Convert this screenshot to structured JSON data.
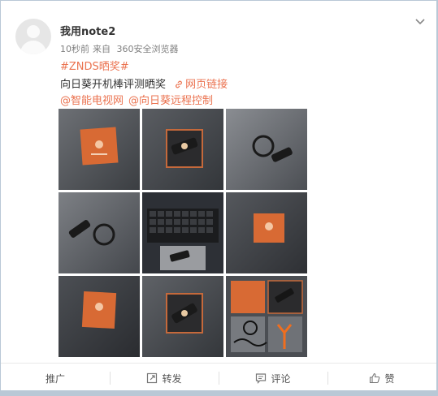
{
  "post": {
    "username": "我用note2",
    "time": "10秒前",
    "from_label": "来自",
    "source": "360安全浏览器",
    "hashtag": "#ZNDS晒奖#",
    "text": "向日葵开机棒评测晒奖",
    "link_label": "网页链接",
    "mention_1": "@智能电视网",
    "mention_2": "@向日葵远程控制"
  },
  "photos": [
    {
      "subject": "orange-box"
    },
    {
      "subject": "stick-on-box"
    },
    {
      "subject": "dell-laptop-stick"
    },
    {
      "subject": "dell-laptop-stick-rotated"
    },
    {
      "subject": "laptop-keyboard"
    },
    {
      "subject": "orange-box"
    },
    {
      "subject": "orange-box"
    },
    {
      "subject": "stick-on-box"
    },
    {
      "subject": "collage"
    }
  ],
  "footer": {
    "promote": "推广",
    "forward": "转发",
    "comment": "评论",
    "like": "赞"
  },
  "colors": {
    "accent": "#eb7350",
    "text": "#333333",
    "meta": "#808080"
  },
  "icons": [
    "chevron-down-icon",
    "link-icon",
    "forward-icon",
    "comment-icon",
    "like-icon"
  ]
}
